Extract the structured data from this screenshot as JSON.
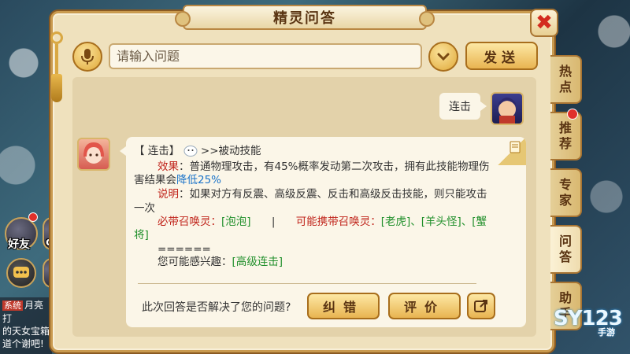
{
  "window": {
    "title": "精灵问答",
    "close_icon": "✖"
  },
  "input": {
    "placeholder": "请输入问题",
    "send_label": "发送"
  },
  "conversation": {
    "user_message": "连击",
    "answer": {
      "heading_prefix": "【 连击】",
      "heading_suffix": ">>被动技能",
      "effect_label": "效果",
      "effect_text_1": "：普通物理攻击，有45%概率发动第二次攻击，拥有此技能物理伤",
      "effect_text_2": "害结果会",
      "effect_highlight": "降低25%",
      "note_label": "说明",
      "note_text_1": "：如果对方有反震、高级反震、反击和高级反击技能，则只能攻击",
      "note_text_2": "一次",
      "must_label": "必带召唤灵：",
      "must_value": "[泡泡]",
      "separator": "|",
      "may_label": "可能携带召唤灵：",
      "may_value_1": "[老虎]、[羊头怪]、[蟹",
      "may_value_2": "将]",
      "rule": "======",
      "interest_label": "您可能感兴趣：",
      "interest_value": "[高级连击]"
    }
  },
  "feedback": {
    "question": "此次回答是否解决了您的问题?",
    "correct_label": "纠错",
    "rate_label": "评价"
  },
  "tabs": [
    {
      "label_1": "热",
      "label_2": "点"
    },
    {
      "label_1": "推",
      "label_2": "荐"
    },
    {
      "label_1": "专",
      "label_2": "家"
    },
    {
      "label_1": "问",
      "label_2": "答"
    },
    {
      "label_1": "助",
      "label_2": "手"
    }
  ],
  "hud": {
    "friends_label": "好友",
    "other_label": "du",
    "chat_system_tag": "系统",
    "chat_line_1": "月亮打",
    "chat_line_2": "的天女宝箱",
    "chat_line_3": "道个谢吧!"
  },
  "watermark": {
    "brand": "SY123",
    "sub": "手游"
  },
  "colors": {
    "panel_bg": "#efe1bd",
    "accent_red": "#c0231a",
    "accent_green": "#1f8f2a",
    "accent_blue": "#1a73c9",
    "button_gold": "#e8b451"
  }
}
